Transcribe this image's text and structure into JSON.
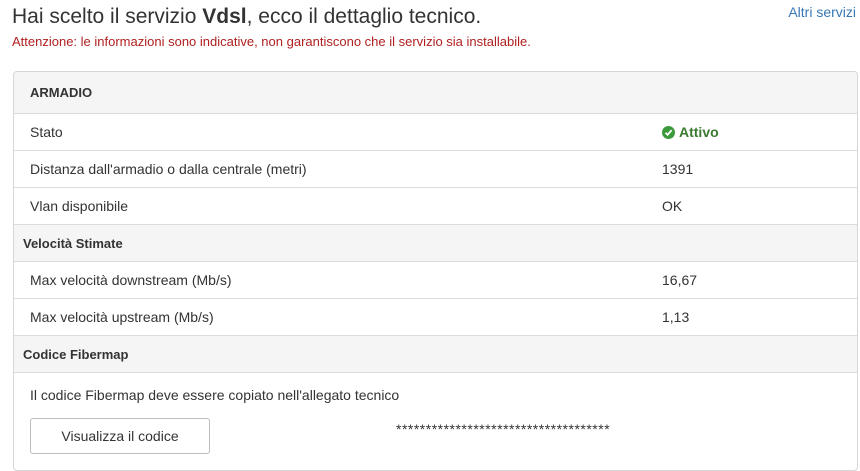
{
  "header": {
    "title_prefix": "Hai scelto il servizio ",
    "title_service": "Vdsl",
    "title_suffix": ", ecco il dettaglio tecnico.",
    "warning": "Attenzione: le informazioni sono indicative, non garantiscono che il servizio sia installabile.",
    "other_services_link": "Altri servizi"
  },
  "panel": {
    "title": "ARMADIO",
    "rows": [
      {
        "label": "Stato",
        "value": "Attivo",
        "status": "active"
      },
      {
        "label": "Distanza dall'armadio o dalla centrale (metri)",
        "value": "1391"
      },
      {
        "label": "Vlan disponibile",
        "value": "OK"
      }
    ],
    "speed_section": {
      "title": "Velocità Stimate",
      "rows": [
        {
          "label": "Max velocità downstream (Mb/s)",
          "value": "16,67"
        },
        {
          "label": "Max velocità upstream (Mb/s)",
          "value": "1,13"
        }
      ]
    },
    "fibermap_section": {
      "title": "Codice Fibermap",
      "note": "Il codice Fibermap deve essere copiato nell'allegato tecnico",
      "button_label": "Visualizza il codice",
      "masked_code": "************************************"
    }
  },
  "colors": {
    "warning": "#b02020",
    "link": "#3a78b5",
    "status_active": "#3c7a32",
    "panel_header_bg": "#f5f5f5"
  },
  "icons": {
    "status_active": "check-circle-icon"
  }
}
